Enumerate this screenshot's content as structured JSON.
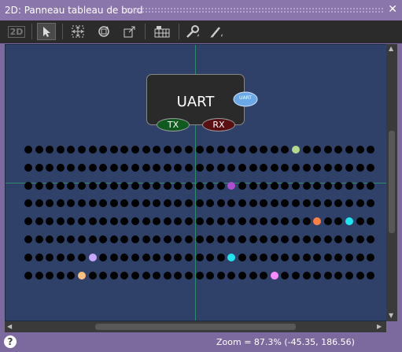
{
  "window": {
    "title": "2D: Panneau tableau de bord",
    "close_label": "✕"
  },
  "toolbar": {
    "view2d_label": "2D"
  },
  "component": {
    "name": "UART",
    "badge": "UART",
    "pin_tx": "TX",
    "pin_rx": "RX",
    "pin_tx_color": "#0f5a1f",
    "pin_rx_color": "#5a0f12"
  },
  "status": {
    "help_label": "?",
    "zoom_text": "Zoom = 87.3% (-45.35, 186.56)"
  },
  "colors": {
    "canvas": "#2f4168",
    "hole": "#000000",
    "crosshair": "#2e8a6a"
  },
  "matrix": {
    "rows": 8,
    "cols": 33,
    "highlights": [
      {
        "row": 0,
        "col": 25,
        "color": "#b5d98a"
      },
      {
        "row": 2,
        "col": 19,
        "color": "#b04ccf"
      },
      {
        "row": 4,
        "col": 27,
        "color": "#ff7f3f"
      },
      {
        "row": 4,
        "col": 30,
        "color": "#1fe6ef"
      },
      {
        "row": 6,
        "col": 6,
        "color": "#c8a8ff"
      },
      {
        "row": 6,
        "col": 19,
        "color": "#1fe6ef"
      },
      {
        "row": 7,
        "col": 5,
        "color": "#ffc07f"
      },
      {
        "row": 7,
        "col": 23,
        "color": "#ff8aff"
      }
    ]
  }
}
